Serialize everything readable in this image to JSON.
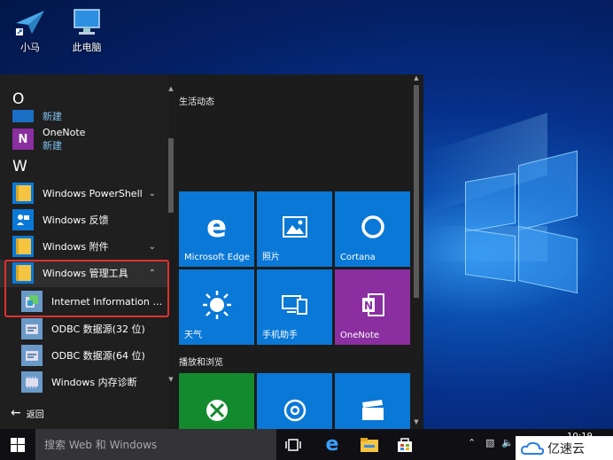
{
  "desktop": {
    "icons": [
      {
        "label": "小马"
      },
      {
        "label": "此电脑"
      }
    ]
  },
  "start_menu": {
    "letters": {
      "o": "O",
      "w": "W"
    },
    "apps": {
      "prev_new": "新建",
      "onenote": {
        "name": "OneNote",
        "tag": "新建"
      },
      "powershell": "Windows PowerShell",
      "feedback": "Windows 反馈",
      "accessories": "Windows 附件",
      "admin_tools": "Windows 管理工具",
      "iis": "Internet Information Ser...",
      "odbc32": "ODBC 数据源(32 位)",
      "odbc64": "ODBC 数据源(64 位)",
      "memdiag": "Windows 内存诊断"
    },
    "back_label": "返回",
    "tiles": {
      "section1": "生活动态",
      "section2": "播放和浏览",
      "items": [
        {
          "label": "Microsoft Edge",
          "color": "#0a78d7"
        },
        {
          "label": "照片",
          "color": "#0a78d7"
        },
        {
          "label": "Cortana",
          "color": "#0a78d7"
        },
        {
          "label": "天气",
          "color": "#0a78d7"
        },
        {
          "label": "手机助手",
          "color": "#0a78d7"
        },
        {
          "label": "OneNote",
          "color": "#8a2ea0"
        },
        {
          "label": "",
          "color": "#138a2e"
        },
        {
          "label": "",
          "color": "#0a78d7"
        },
        {
          "label": "",
          "color": "#0a78d7"
        }
      ]
    }
  },
  "taskbar": {
    "search_placeholder": "搜索 Web 和 Windows",
    "clock": "10:19",
    "watermark": "亿速云"
  },
  "colors": {
    "accent": "#0a78d7",
    "highlight_border": "#e0302b"
  }
}
